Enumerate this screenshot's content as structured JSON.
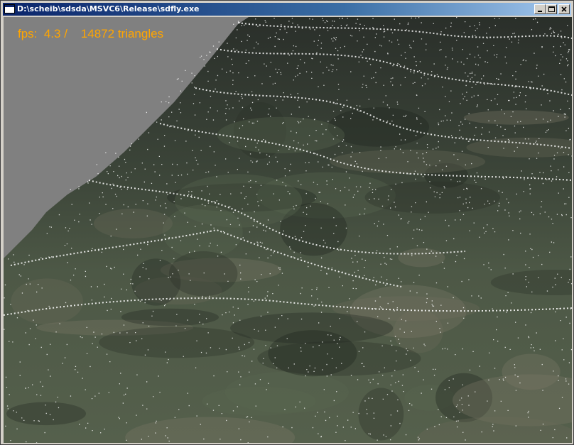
{
  "window": {
    "title": "D:\\scheib\\sdsda\\MSVC6\\Release\\sdfly.exe",
    "buttons": {
      "minimize": "minimize-icon",
      "maximize": "maximize-icon",
      "close": "close-icon"
    }
  },
  "overlay": {
    "fps_text": "fps:  4.3 /    14872 triangles"
  },
  "colors": {
    "background": "#808080",
    "overlay_text": "#ffa500",
    "titlebar": "#0a246a"
  }
}
